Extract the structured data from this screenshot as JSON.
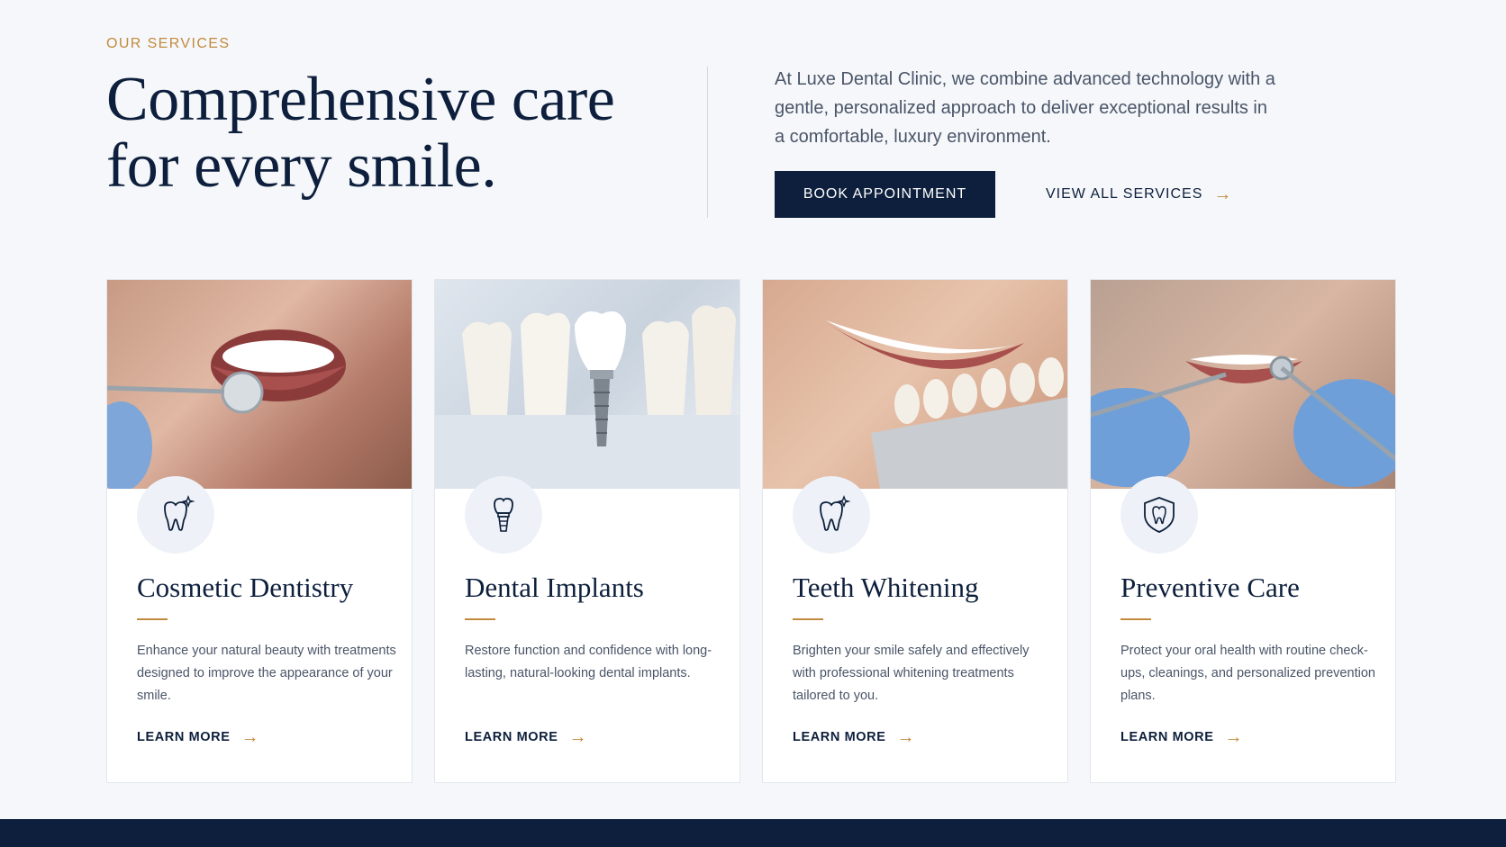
{
  "header": {
    "eyebrow": "OUR SERVICES",
    "headline_line1": "Comprehensive care",
    "headline_line2": "for every smile.",
    "intro": "At Luxe Dental Clinic, we combine advanced technology with a gentle, personalized approach to deliver exceptional results in a comfortable, luxury environment.",
    "book_label": "BOOK APPOINTMENT",
    "view_all_label": "VIEW ALL SERVICES",
    "arrow": "→"
  },
  "colors": {
    "navy": "#0d1f3c",
    "gold": "#c28a3d",
    "background": "#f5f7fa"
  },
  "services": [
    {
      "icon": "sparkle-tooth-icon",
      "title": "Cosmetic Dentistry",
      "description": "Enhance your natural beauty with treatments designed to improve the appearance of your smile.",
      "link": "LEARN MORE"
    },
    {
      "icon": "implant-icon",
      "title": "Dental Implants",
      "description": "Restore function and confidence with long-lasting, natural-looking dental implants.",
      "link": "LEARN MORE"
    },
    {
      "icon": "sparkle-tooth-icon",
      "title": "Teeth Whitening",
      "description": "Brighten your smile safely and effectively with professional whitening treatments tailored to you.",
      "link": "LEARN MORE"
    },
    {
      "icon": "shield-tooth-icon",
      "title": "Preventive Care",
      "description": "Protect your oral health with routine check-ups, cleanings, and personalized prevention plans.",
      "link": "LEARN MORE"
    }
  ]
}
